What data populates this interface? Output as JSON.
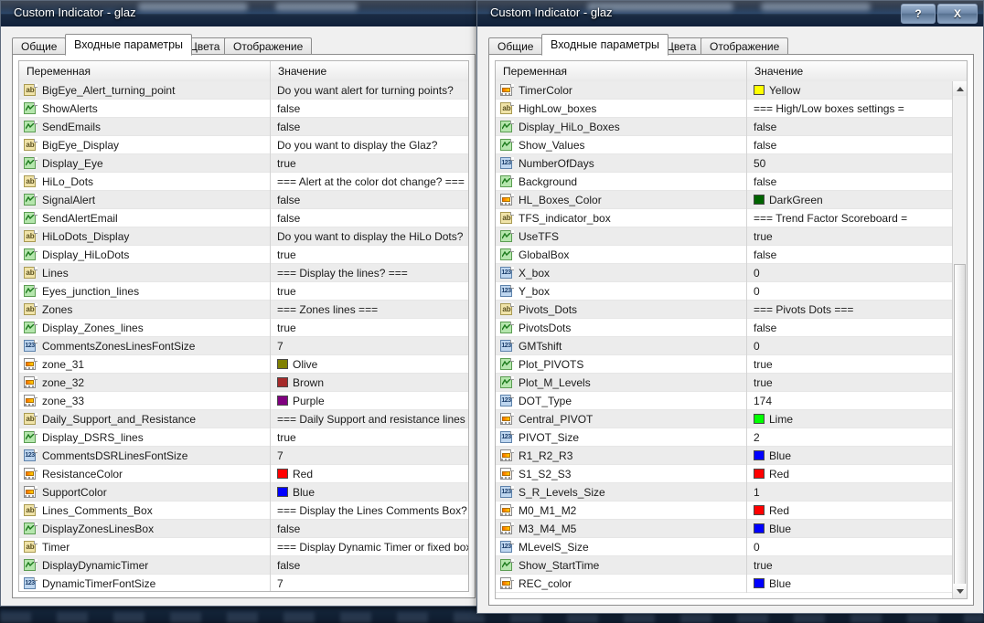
{
  "colors": {
    "Yellow": "#ffff00",
    "DarkGreen": "#006400",
    "Olive": "#808000",
    "Brown": "#a52a2a",
    "Purple": "#800080",
    "Red": "#ff0000",
    "Blue": "#0000ff",
    "Lime": "#00ff00"
  },
  "grid_headers": {
    "variable": "Переменная",
    "value": "Значение"
  },
  "tabs": [
    "Общие",
    "Входные параметры",
    "Цвета",
    "Отображение"
  ],
  "active_tab": "Входные параметры",
  "left_window": {
    "title": "Custom Indicator - glaz",
    "tabs": [
      "Общие",
      "Входные параметры",
      "Цвета",
      "Отображение"
    ],
    "active_tab_index": 1,
    "headers": {
      "variable": "Переменная",
      "value": "Значение"
    },
    "rows": [
      {
        "icon": "string",
        "name": "BigEye_Alert_turning_point",
        "value": "Do you want alert for turning points?"
      },
      {
        "icon": "bool",
        "name": "ShowAlerts",
        "value": "false"
      },
      {
        "icon": "bool",
        "name": "SendEmails",
        "value": "false"
      },
      {
        "icon": "string",
        "name": "BigEye_Display",
        "value": "Do you want to display the Glaz?"
      },
      {
        "icon": "bool",
        "name": "Display_Eye",
        "value": "true"
      },
      {
        "icon": "string",
        "name": "HiLo_Dots",
        "value": "=== Alert at the color dot change? ==="
      },
      {
        "icon": "bool",
        "name": "SignalAlert",
        "value": "false"
      },
      {
        "icon": "bool",
        "name": "SendAlertEmail",
        "value": "false"
      },
      {
        "icon": "string",
        "name": "HiLoDots_Display",
        "value": "Do you want to display the HiLo Dots?"
      },
      {
        "icon": "bool",
        "name": "Display_HiLoDots",
        "value": "true"
      },
      {
        "icon": "string",
        "name": "Lines",
        "value": "=== Display the lines? ==="
      },
      {
        "icon": "bool",
        "name": "Eyes_junction_lines",
        "value": "true"
      },
      {
        "icon": "string",
        "name": "Zones",
        "value": "=== Zones lines ==="
      },
      {
        "icon": "bool",
        "name": "Display_Zones_lines",
        "value": "true"
      },
      {
        "icon": "int",
        "name": "CommentsZonesLinesFontSize",
        "value": "7"
      },
      {
        "icon": "color",
        "name": "zone_31",
        "value": "Olive",
        "swatch": "Olive"
      },
      {
        "icon": "color",
        "name": "zone_32",
        "value": "Brown",
        "swatch": "Brown"
      },
      {
        "icon": "color",
        "name": "zone_33",
        "value": "Purple",
        "swatch": "Purple"
      },
      {
        "icon": "string",
        "name": "Daily_Support_and_Resistance",
        "value": "=== Daily Support and resistance lines ="
      },
      {
        "icon": "bool",
        "name": "Display_DSRS_lines",
        "value": "true"
      },
      {
        "icon": "int",
        "name": "CommentsDSRLinesFontSize",
        "value": "7"
      },
      {
        "icon": "color",
        "name": "ResistanceColor",
        "value": "Red",
        "swatch": "Red"
      },
      {
        "icon": "color",
        "name": "SupportColor",
        "value": "Blue",
        "swatch": "Blue"
      },
      {
        "icon": "string",
        "name": "Lines_Comments_Box",
        "value": "=== Display the Lines Comments Box? ="
      },
      {
        "icon": "bool",
        "name": "DisplayZonesLinesBox",
        "value": "false"
      },
      {
        "icon": "string",
        "name": "Timer",
        "value": "=== Display Dynamic Timer or fixed box?"
      },
      {
        "icon": "bool",
        "name": "DisplayDynamicTimer",
        "value": "false"
      },
      {
        "icon": "int",
        "name": "DynamicTimerFontSize",
        "value": "7"
      }
    ]
  },
  "right_window": {
    "title": "Custom Indicator - glaz",
    "help_button": "?",
    "close_button": "X",
    "tabs": [
      "Общие",
      "Входные параметры",
      "Цвета",
      "Отображение"
    ],
    "active_tab_index": 1,
    "headers": {
      "variable": "Переменная",
      "value": "Значение"
    },
    "rows": [
      {
        "icon": "color",
        "name": "TimerColor",
        "value": "Yellow",
        "swatch": "Yellow"
      },
      {
        "icon": "string",
        "name": "HighLow_boxes",
        "value": "=== High/Low boxes settings ="
      },
      {
        "icon": "bool",
        "name": "Display_HiLo_Boxes",
        "value": "false"
      },
      {
        "icon": "bool",
        "name": "Show_Values",
        "value": "false"
      },
      {
        "icon": "int",
        "name": "NumberOfDays",
        "value": "50"
      },
      {
        "icon": "bool",
        "name": "Background",
        "value": "false"
      },
      {
        "icon": "color",
        "name": "HL_Boxes_Color",
        "value": "DarkGreen",
        "swatch": "DarkGreen"
      },
      {
        "icon": "string",
        "name": "TFS_indicator_box",
        "value": "=== Trend Factor Scoreboard ="
      },
      {
        "icon": "bool",
        "name": "UseTFS",
        "value": "true"
      },
      {
        "icon": "bool",
        "name": "GlobalBox",
        "value": "false"
      },
      {
        "icon": "int",
        "name": "X_box",
        "value": "0"
      },
      {
        "icon": "int",
        "name": "Y_box",
        "value": "0"
      },
      {
        "icon": "string",
        "name": "Pivots_Dots",
        "value": "=== Pivots Dots ==="
      },
      {
        "icon": "bool",
        "name": "PivotsDots",
        "value": "false"
      },
      {
        "icon": "int",
        "name": "GMTshift",
        "value": "0"
      },
      {
        "icon": "bool",
        "name": "Plot_PIVOTS",
        "value": "true"
      },
      {
        "icon": "bool",
        "name": "Plot_M_Levels",
        "value": "true"
      },
      {
        "icon": "int",
        "name": "DOT_Type",
        "value": "174"
      },
      {
        "icon": "color",
        "name": "Central_PIVOT",
        "value": "Lime",
        "swatch": "Lime"
      },
      {
        "icon": "int",
        "name": "PIVOT_Size",
        "value": "2"
      },
      {
        "icon": "color",
        "name": "R1_R2_R3",
        "value": "Blue",
        "swatch": "Blue"
      },
      {
        "icon": "color",
        "name": "S1_S2_S3",
        "value": "Red",
        "swatch": "Red"
      },
      {
        "icon": "int",
        "name": "S_R_Levels_Size",
        "value": "1"
      },
      {
        "icon": "color",
        "name": "M0_M1_M2",
        "value": "Red",
        "swatch": "Red"
      },
      {
        "icon": "color",
        "name": "M3_M4_M5",
        "value": "Blue",
        "swatch": "Blue"
      },
      {
        "icon": "int",
        "name": "MLevelS_Size",
        "value": "0"
      },
      {
        "icon": "bool",
        "name": "Show_StartTime",
        "value": "true"
      },
      {
        "icon": "color",
        "name": "REC_color",
        "value": "Blue",
        "swatch": "Blue"
      }
    ],
    "scrollbar": {
      "up_arrow": "▲",
      "down_arrow": "▼"
    }
  }
}
